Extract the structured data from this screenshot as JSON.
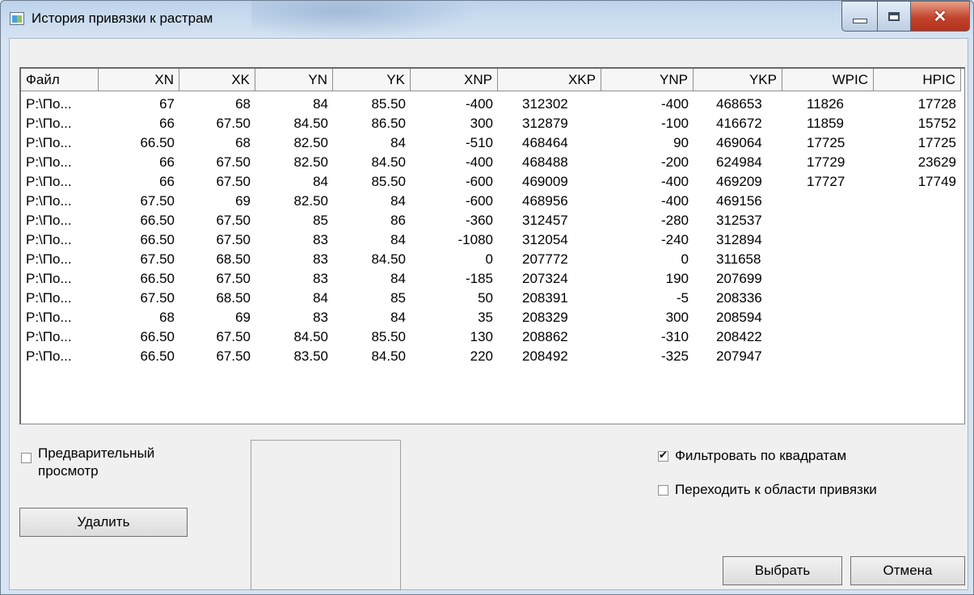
{
  "window": {
    "title": "История привязки к растрам"
  },
  "table": {
    "columns": [
      "Файл",
      "XN",
      "XK",
      "YN",
      "YK",
      "XNP",
      "XKP",
      "YNP",
      "YKP",
      "WPIC",
      "HPIC"
    ],
    "rows": [
      [
        "P:\\По...",
        "67",
        "68",
        "84",
        "85.50",
        "-400",
        "312302",
        "-400",
        "468653",
        "11826",
        "17728"
      ],
      [
        "P:\\По...",
        "66",
        "67.50",
        "84.50",
        "86.50",
        "300",
        "312879",
        "-100",
        "416672",
        "11859",
        "15752"
      ],
      [
        "P:\\По...",
        "66.50",
        "68",
        "82.50",
        "84",
        "-510",
        "468464",
        "90",
        "469064",
        "17725",
        "17725"
      ],
      [
        "P:\\По...",
        "66",
        "67.50",
        "82.50",
        "84.50",
        "-400",
        "468488",
        "-200",
        "624984",
        "17729",
        "23629"
      ],
      [
        "P:\\По...",
        "66",
        "67.50",
        "84",
        "85.50",
        "-600",
        "469009",
        "-400",
        "469209",
        "17727",
        "17749"
      ],
      [
        "P:\\По...",
        "67.50",
        "69",
        "82.50",
        "84",
        "-600",
        "468956",
        "-400",
        "469156",
        "",
        ""
      ],
      [
        "P:\\По...",
        "66.50",
        "67.50",
        "85",
        "86",
        "-360",
        "312457",
        "-280",
        "312537",
        "",
        ""
      ],
      [
        "P:\\По...",
        "66.50",
        "67.50",
        "83",
        "84",
        "-1080",
        "312054",
        "-240",
        "312894",
        "",
        ""
      ],
      [
        "P:\\По...",
        "67.50",
        "68.50",
        "83",
        "84.50",
        "0",
        "207772",
        "0",
        "311658",
        "",
        ""
      ],
      [
        "P:\\По...",
        "66.50",
        "67.50",
        "83",
        "84",
        "-185",
        "207324",
        "190",
        "207699",
        "",
        ""
      ],
      [
        "P:\\По...",
        "67.50",
        "68.50",
        "84",
        "85",
        "50",
        "208391",
        "-5",
        "208336",
        "",
        ""
      ],
      [
        "P:\\По...",
        "68",
        "69",
        "83",
        "84",
        "35",
        "208329",
        "300",
        "208594",
        "",
        ""
      ],
      [
        "P:\\По...",
        "66.50",
        "67.50",
        "84.50",
        "85.50",
        "130",
        "208862",
        "-310",
        "208422",
        "",
        ""
      ],
      [
        "P:\\По...",
        "66.50",
        "67.50",
        "83.50",
        "84.50",
        "220",
        "208492",
        "-325",
        "207947",
        "",
        ""
      ]
    ]
  },
  "preview_checkbox": {
    "label_line1": "Предварительный",
    "label_line2": "просмотр",
    "checked": false
  },
  "filter_checkbox": {
    "label": "Фильтровать по квадратам",
    "checked": true
  },
  "goto_checkbox": {
    "label": "Переходить к области привязки",
    "checked": false
  },
  "buttons": {
    "delete": "Удалить",
    "select": "Выбрать",
    "cancel": "Отмена"
  },
  "icons": {
    "window_icon": "raster-icon",
    "minimize": "minimize-icon",
    "maximize": "maximize-icon",
    "close": "close-icon"
  }
}
